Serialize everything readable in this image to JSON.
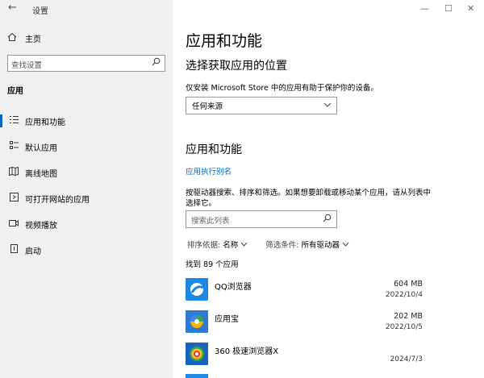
{
  "window": {
    "title": "设置",
    "back_glyph": "←",
    "minimize": "—",
    "maximize": "☐",
    "close": "✕"
  },
  "sidebar": {
    "home_label": "主页",
    "search_placeholder": "查找设置",
    "section": "应用",
    "items": [
      {
        "label": "应用和功能",
        "icon": "apps-features-icon",
        "active": true
      },
      {
        "label": "默认应用",
        "icon": "default-apps-icon",
        "active": false
      },
      {
        "label": "离线地图",
        "icon": "offline-maps-icon",
        "active": false
      },
      {
        "label": "可打开网站的应用",
        "icon": "apps-for-websites-icon",
        "active": false
      },
      {
        "label": "视频播放",
        "icon": "video-playback-icon",
        "active": false
      },
      {
        "label": "启动",
        "icon": "startup-icon",
        "active": false
      }
    ]
  },
  "main": {
    "title": "应用和功能",
    "install_section": {
      "heading": "选择获取应用的位置",
      "text": "仅安装 Microsoft Store 中的应用有助于保护你的设备。",
      "dropdown_value": "任何来源"
    },
    "apps_section": {
      "heading": "应用和功能",
      "alias_link": "应用执行别名",
      "description": "按驱动器搜索、排序和筛选。如果想要卸载或移动某个应用，请从列表中选择它。",
      "search_placeholder": "搜索此列表",
      "sort_label": "排序依据:",
      "sort_value": "名称",
      "filter_label": "筛选条件:",
      "filter_value": "所有驱动器",
      "count_text": "找到 89 个应用"
    },
    "apps": [
      {
        "name": "QQ浏览器",
        "size": "604 MB",
        "date": "2022/10/4",
        "color": "#1e88e5"
      },
      {
        "name": "应用宝",
        "size": "202 MB",
        "date": "2022/10/5",
        "color": "#2e7bd6"
      },
      {
        "name": "360 极速浏览器X",
        "size": "",
        "date": "2024/7/3",
        "color": "#1565c0"
      }
    ]
  },
  "colors": {
    "accent": "#0067c0",
    "sidebar_bg": "#f0f0f0"
  }
}
